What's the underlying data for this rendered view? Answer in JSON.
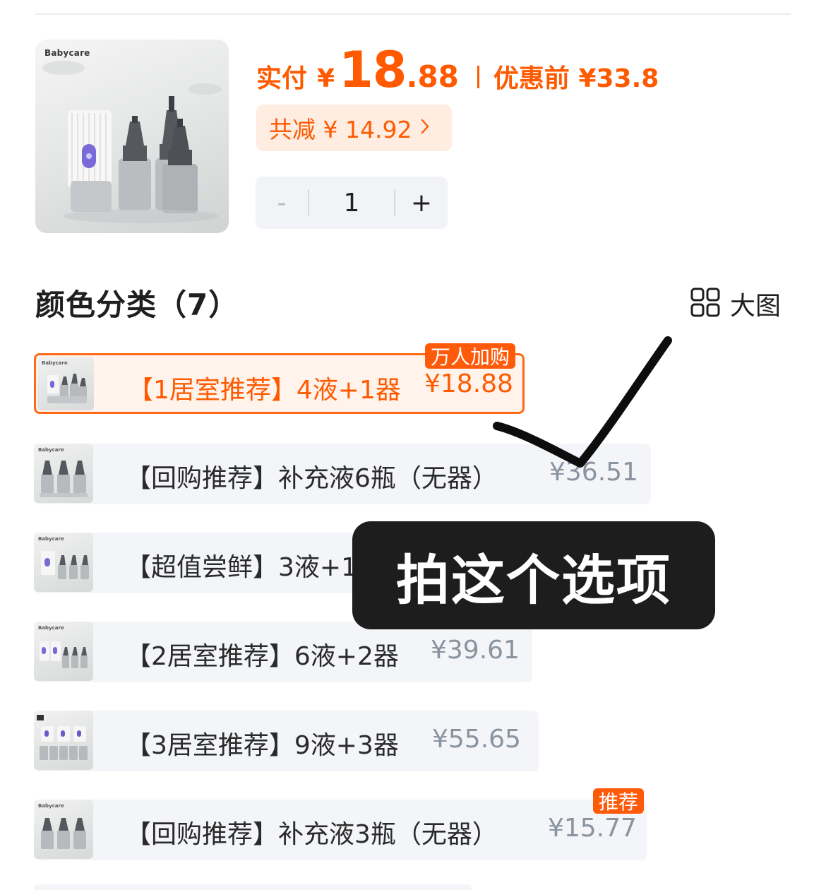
{
  "product": {
    "brand": "Babycare",
    "pay_label": "实付",
    "currency": "¥",
    "price_int": "18",
    "price_dec": ".88",
    "original_label": "优惠前 ¥33.8",
    "discount_label": "共减 ¥ 14.92",
    "discount_chevron": "chevron-right-icon"
  },
  "quantity": {
    "minus": "-",
    "value": "1",
    "plus": "+"
  },
  "section": {
    "title": "颜色分类（7）",
    "big_view_icon": "grid-icon",
    "big_view_label": "大图"
  },
  "options": [
    {
      "label": "【1居室推荐】4液+1器",
      "price": "¥18.88",
      "selected": true,
      "tag": "万人加购"
    },
    {
      "label": "【回购推荐】补充液6瓶（无器）",
      "price": "¥36.51",
      "selected": false
    },
    {
      "label": "【超值尝鲜】3液+1器",
      "price": "",
      "selected": false
    },
    {
      "label": "【2居室推荐】6液+2器",
      "price": "¥39.61",
      "selected": false
    },
    {
      "label": "【3居室推荐】9液+3器",
      "price": "¥55.65",
      "selected": false
    },
    {
      "label": "【回购推荐】补充液3瓶（无器）",
      "price": "¥15.77",
      "selected": false,
      "tag": "推荐"
    }
  ],
  "annotation": {
    "text": "拍这个选项",
    "mark": "checkmark-icon"
  },
  "colors": {
    "accent": "#ff5a00",
    "chip_bg": "#ffede2",
    "option_bg": "#f3f5f8",
    "overlay_bg": "#1d1d1d"
  }
}
